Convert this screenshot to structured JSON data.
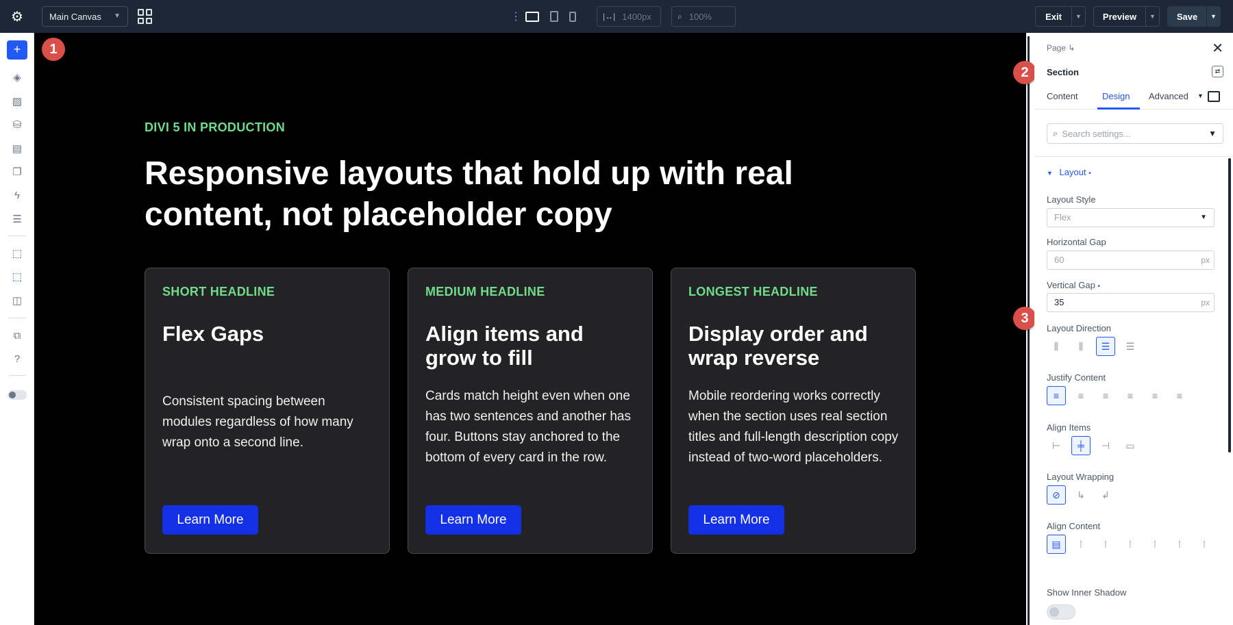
{
  "topbar": {
    "canvas_name": "Main Canvas",
    "width_value": "1400px",
    "zoom_value": "100%",
    "exit_label": "Exit",
    "preview_label": "Preview",
    "save_label": "Save"
  },
  "canvas": {
    "eyebrow": "DIVI 5 IN PRODUCTION",
    "headline": "Responsive layouts that hold up with real content, not placeholder copy",
    "cards": [
      {
        "kicker": "SHORT HEADLINE",
        "title": "Flex Gaps",
        "body": "Consistent spacing between modules regardless of how many wrap onto a second line.",
        "button": "Learn More"
      },
      {
        "kicker": "MEDIUM HEADLINE",
        "title": "Align items and grow to fill",
        "body": "Cards match height even when one has two sentences and another has four. Buttons stay anchored to the bottom of every card in the row.",
        "button": "Learn More"
      },
      {
        "kicker": "LONGEST HEADLINE",
        "title": "Display order and wrap reverse",
        "body": "Mobile reordering works correctly when the section uses real section titles and full-length description copy instead of two-word placeholders.",
        "button": "Learn More"
      }
    ],
    "badges": [
      "1",
      "2",
      "3"
    ]
  },
  "panel": {
    "breadcrumb": "Page ↳",
    "title": "Section",
    "tabs": [
      "Content",
      "Design",
      "Advanced"
    ],
    "active_tab": "Design",
    "search_placeholder": "Search settings...",
    "section": "Layout",
    "fields": {
      "layout_style_label": "Layout Style",
      "layout_style_value": "Flex",
      "h_gap_label": "Horizontal Gap",
      "h_gap_placeholder": "60",
      "v_gap_label": "Vertical Gap",
      "v_gap_value": "35",
      "unit": "px",
      "layout_direction_label": "Layout Direction",
      "justify_content_label": "Justify Content",
      "align_items_label": "Align Items",
      "layout_wrapping_label": "Layout Wrapping",
      "align_content_label": "Align Content",
      "inner_shadow_label": "Show Inner Shadow"
    }
  },
  "colors": {
    "accent": "#2259f3",
    "green": "#6fdc8c",
    "button": "#1430e6",
    "badge": "#d94f4a",
    "topbar": "#1d2736"
  }
}
